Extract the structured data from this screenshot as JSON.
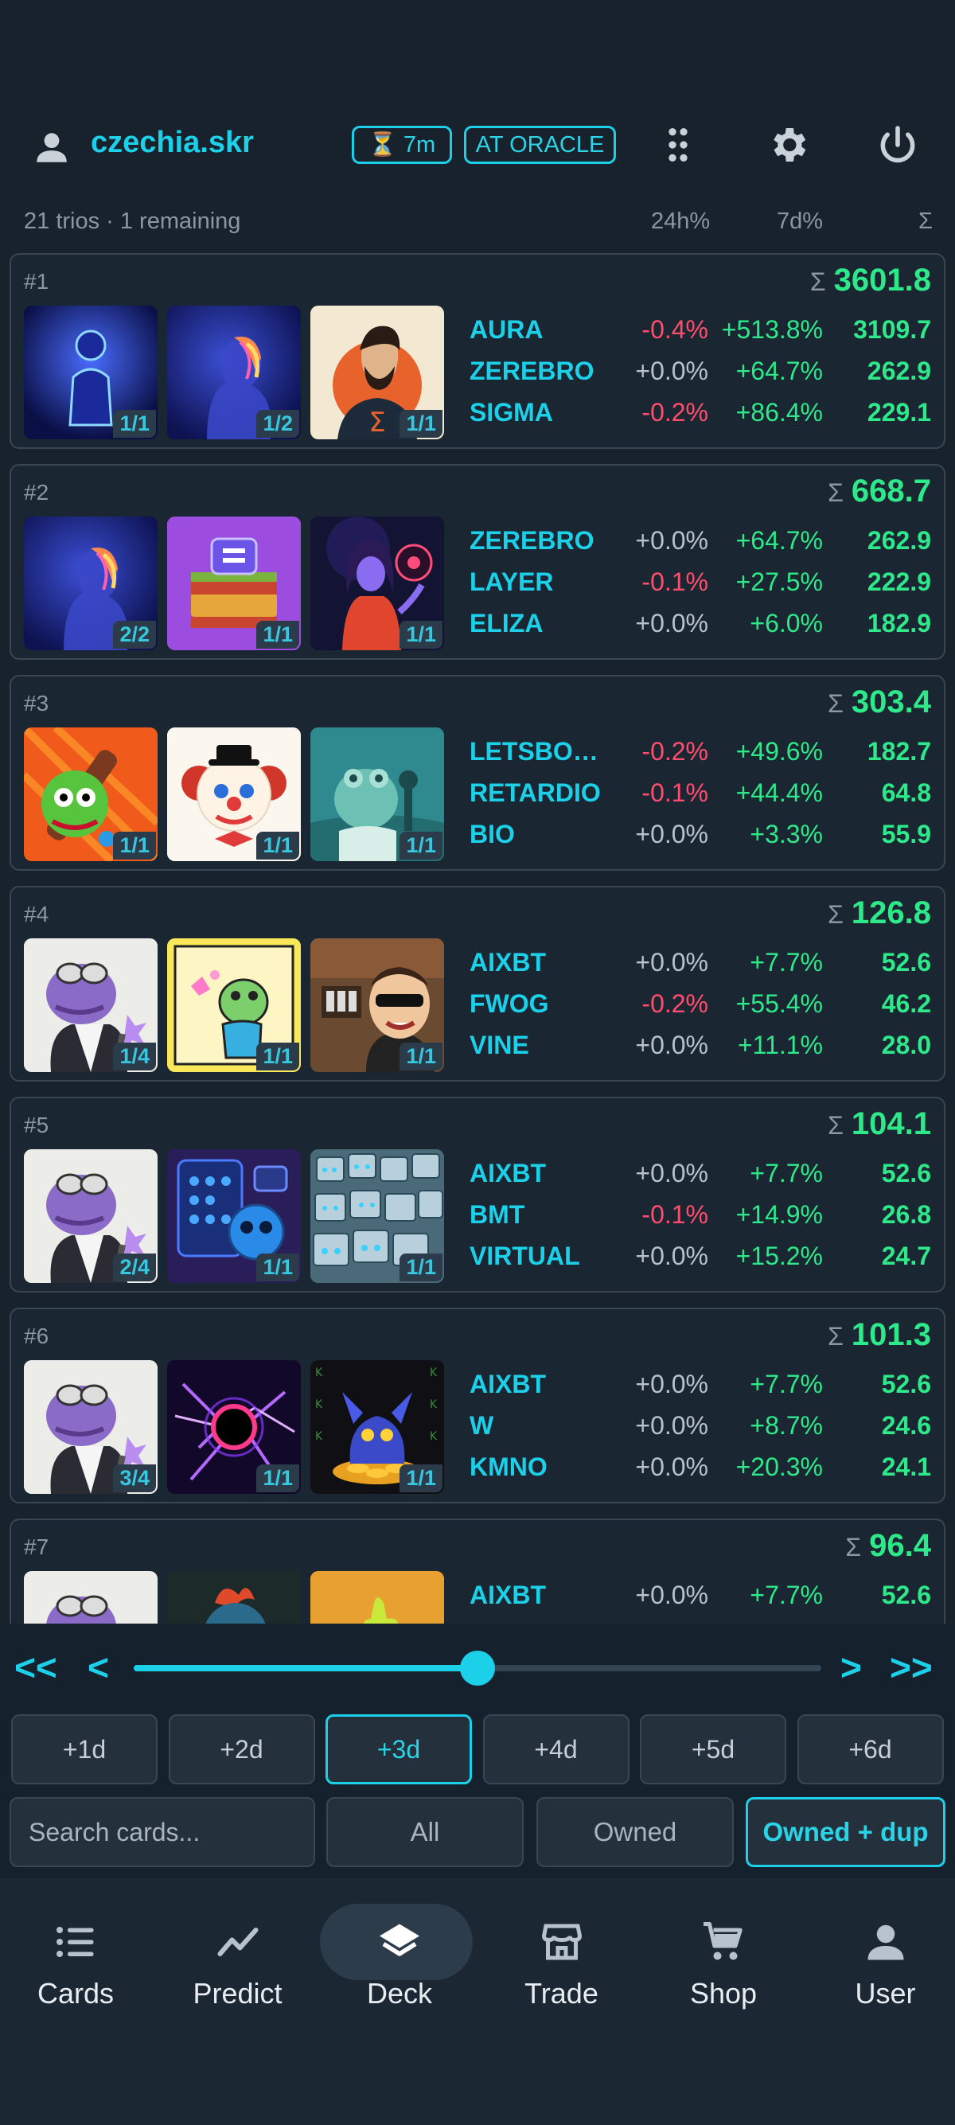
{
  "header": {
    "username": "czechia.skr",
    "timer": "⏳ 7m",
    "oracle": "AT ORACLE",
    "icons": [
      "user-icon",
      "apps-grid-icon",
      "settings-gear-icon",
      "power-icon"
    ]
  },
  "summary": {
    "text": "21 trios · 1 remaining",
    "col_24h": "24h%",
    "col_7d": "7d%",
    "col_sum": "Σ"
  },
  "trios": [
    {
      "rank": "#1",
      "sigma": "Σ",
      "total": "3601.8",
      "cards": [
        {
          "badge": "1/1",
          "art": "aura"
        },
        {
          "badge": "1/2",
          "art": "zerebro"
        },
        {
          "badge": "1/1",
          "art": "sigma"
        }
      ],
      "rows": [
        {
          "sym": "AURA",
          "p24": "-0.4%",
          "p24s": "neg",
          "p7": "+513.8%",
          "val": "3109.7"
        },
        {
          "sym": "ZEREBRO",
          "p24": "+0.0%",
          "p24s": "zero",
          "p7": "+64.7%",
          "val": "262.9"
        },
        {
          "sym": "SIGMA",
          "p24": "-0.2%",
          "p24s": "neg",
          "p7": "+86.4%",
          "val": "229.1"
        }
      ]
    },
    {
      "rank": "#2",
      "sigma": "Σ",
      "total": "668.7",
      "cards": [
        {
          "badge": "2/2",
          "art": "zerebro"
        },
        {
          "badge": "1/1",
          "art": "layer"
        },
        {
          "badge": "1/1",
          "art": "eliza"
        }
      ],
      "rows": [
        {
          "sym": "ZEREBRO",
          "p24": "+0.0%",
          "p24s": "zero",
          "p7": "+64.7%",
          "val": "262.9"
        },
        {
          "sym": "LAYER",
          "p24": "-0.1%",
          "p24s": "neg",
          "p7": "+27.5%",
          "val": "222.9"
        },
        {
          "sym": "ELIZA",
          "p24": "+0.0%",
          "p24s": "zero",
          "p7": "+6.0%",
          "val": "182.9"
        }
      ]
    },
    {
      "rank": "#3",
      "sigma": "Σ",
      "total": "303.4",
      "cards": [
        {
          "badge": "1/1",
          "art": "letsbonk"
        },
        {
          "badge": "1/1",
          "art": "clown"
        },
        {
          "badge": "1/1",
          "art": "frogsci"
        }
      ],
      "rows": [
        {
          "sym": "LETSBO…",
          "p24": "-0.2%",
          "p24s": "neg",
          "p7": "+49.6%",
          "val": "182.7"
        },
        {
          "sym": "RETARDIO",
          "p24": "-0.1%",
          "p24s": "neg",
          "p7": "+44.4%",
          "val": "64.8"
        },
        {
          "sym": "BIO",
          "p24": "+0.0%",
          "p24s": "zero",
          "p7": "+3.3%",
          "val": "55.9"
        }
      ]
    },
    {
      "rank": "#4",
      "sigma": "Σ",
      "total": "126.8",
      "cards": [
        {
          "badge": "1/4",
          "art": "aixbt"
        },
        {
          "badge": "1/1",
          "art": "fwog"
        },
        {
          "badge": "1/1",
          "art": "vine"
        }
      ],
      "rows": [
        {
          "sym": "AIXBT",
          "p24": "+0.0%",
          "p24s": "zero",
          "p7": "+7.7%",
          "val": "52.6"
        },
        {
          "sym": "FWOG",
          "p24": "-0.2%",
          "p24s": "neg",
          "p7": "+55.4%",
          "val": "46.2"
        },
        {
          "sym": "VINE",
          "p24": "+0.0%",
          "p24s": "zero",
          "p7": "+11.1%",
          "val": "28.0"
        }
      ]
    },
    {
      "rank": "#5",
      "sigma": "Σ",
      "total": "104.1",
      "cards": [
        {
          "badge": "2/4",
          "art": "aixbt"
        },
        {
          "badge": "1/1",
          "art": "bmt"
        },
        {
          "badge": "1/1",
          "art": "virtual"
        }
      ],
      "rows": [
        {
          "sym": "AIXBT",
          "p24": "+0.0%",
          "p24s": "zero",
          "p7": "+7.7%",
          "val": "52.6"
        },
        {
          "sym": "BMT",
          "p24": "-0.1%",
          "p24s": "neg",
          "p7": "+14.9%",
          "val": "26.8"
        },
        {
          "sym": "VIRTUAL",
          "p24": "+0.0%",
          "p24s": "zero",
          "p7": "+15.2%",
          "val": "24.7"
        }
      ]
    },
    {
      "rank": "#6",
      "sigma": "Σ",
      "total": "101.3",
      "cards": [
        {
          "badge": "3/4",
          "art": "aixbt"
        },
        {
          "badge": "1/1",
          "art": "wormhole"
        },
        {
          "badge": "1/1",
          "art": "kmno"
        }
      ],
      "rows": [
        {
          "sym": "AIXBT",
          "p24": "+0.0%",
          "p24s": "zero",
          "p7": "+7.7%",
          "val": "52.6"
        },
        {
          "sym": "W",
          "p24": "+0.0%",
          "p24s": "zero",
          "p7": "+8.7%",
          "val": "24.6"
        },
        {
          "sym": "KMNO",
          "p24": "+0.0%",
          "p24s": "zero",
          "p7": "+20.3%",
          "val": "24.1"
        }
      ]
    },
    {
      "rank": "#7",
      "sigma": "Σ",
      "total": "96.4",
      "cards": [
        {
          "badge": "",
          "art": "aixbt"
        },
        {
          "badge": "",
          "art": "rooster"
        },
        {
          "badge": "",
          "art": "hand"
        }
      ],
      "rows": [
        {
          "sym": "AIXBT",
          "p24": "+0.0%",
          "p24s": "zero",
          "p7": "+7.7%",
          "val": "52.6"
        }
      ]
    }
  ],
  "slider": {
    "first": "<<",
    "prev": "<",
    "next": ">",
    "last": ">>",
    "position": 0.5
  },
  "days": [
    "+1d",
    "+2d",
    "+3d",
    "+4d",
    "+5d",
    "+6d"
  ],
  "active_day": 2,
  "search": {
    "placeholder": "Search cards..."
  },
  "filters": [
    "All",
    "Owned",
    "Owned + dup"
  ],
  "active_filter": 2,
  "nav": [
    {
      "label": "Cards",
      "icon": "list-icon"
    },
    {
      "label": "Predict",
      "icon": "trend-line-icon"
    },
    {
      "label": "Deck",
      "icon": "layers-icon"
    },
    {
      "label": "Trade",
      "icon": "storefront-icon"
    },
    {
      "label": "Shop",
      "icon": "cart-icon"
    },
    {
      "label": "User",
      "icon": "user-icon"
    }
  ],
  "active_nav": 2,
  "colors": {
    "accent": "#1bd0e8",
    "positive": "#2ee98a",
    "negative": "#ff4d6d",
    "background": "#17222d"
  }
}
